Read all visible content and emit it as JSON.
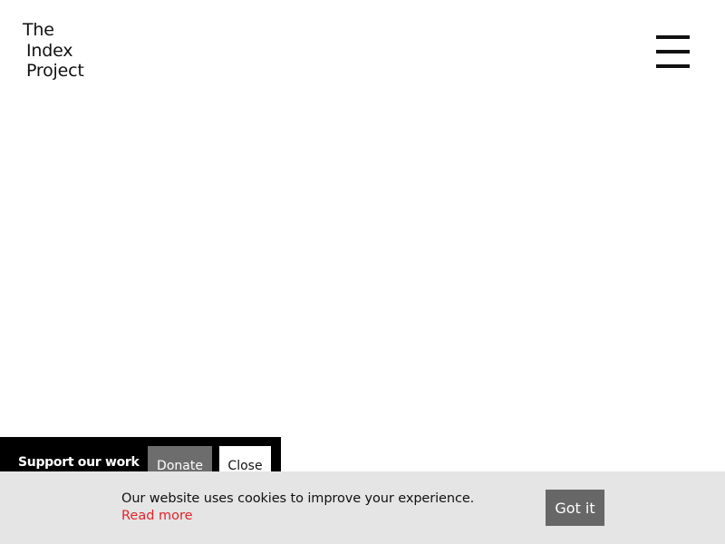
{
  "header": {
    "logo_lines": [
      "The",
      "Index",
      "Project"
    ],
    "menu_icon": "hamburger-menu-icon"
  },
  "support_banner": {
    "label": "Support our work",
    "donate_label": "Donate",
    "close_label": "Close"
  },
  "cookie_banner": {
    "message": "Our website uses cookies to improve your experience.",
    "read_more_label": "Read more",
    "accept_label": "Got it"
  },
  "colors": {
    "background": "#ffffff",
    "text": "#111111",
    "support_banner_bg": "#000000",
    "donate_button_bg": "#6d6d6d",
    "cookie_bar_bg": "#e5e5e5",
    "read_more_link": "#e0242a",
    "got_it_button_bg": "#676767"
  }
}
